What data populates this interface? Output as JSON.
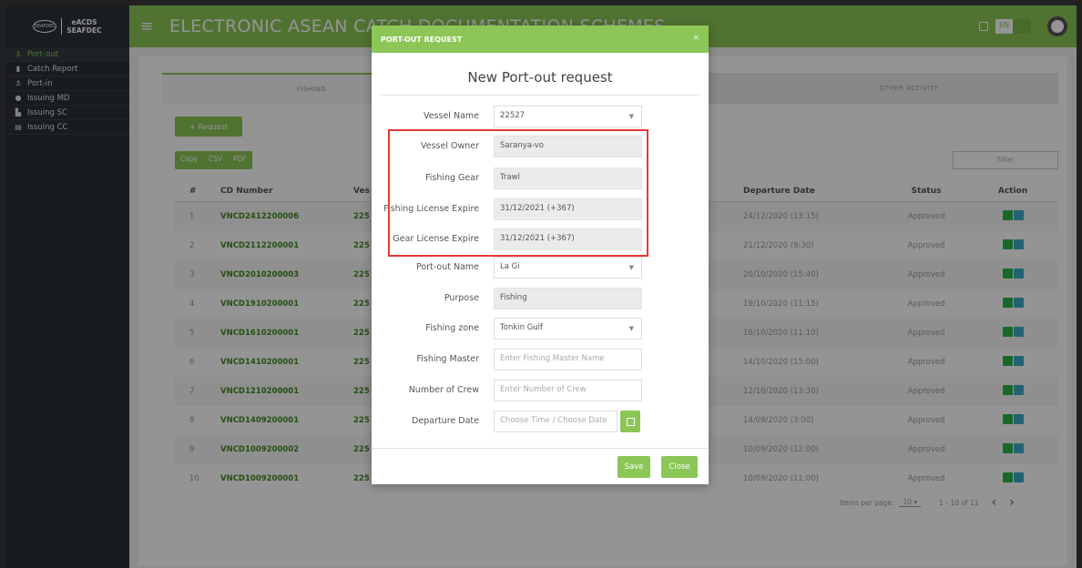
{
  "header": {
    "logo_mark": "SEAFDEC",
    "logo_line1": "eACDS",
    "logo_line2": "SEAFDEC",
    "title": "ELECTRONIC ASEAN CATCH DOCUMENTATION SCHEMES",
    "language": "EN",
    "menu_icon": "hamburger-icon"
  },
  "sidebar": {
    "items": [
      {
        "label": "Port-out",
        "icon": "ship-icon",
        "active": true
      },
      {
        "label": "Catch Report",
        "icon": "document-icon",
        "active": false
      },
      {
        "label": "Port-in",
        "icon": "anchor-icon",
        "active": false
      },
      {
        "label": "Issuing MD",
        "icon": "info-circle-icon",
        "active": false
      },
      {
        "label": "Issuing SC",
        "icon": "bar-chart-icon",
        "active": false
      },
      {
        "label": "Issuing CC",
        "icon": "card-icon",
        "active": false
      }
    ]
  },
  "main": {
    "tabs": [
      {
        "label": "FISHING"
      },
      {
        "label": "OTHER ACTIVITY"
      }
    ],
    "request_button": "+ Request",
    "export_buttons": [
      "Copy",
      "CSV",
      "PDF"
    ],
    "filter_placeholder": "Filter",
    "table": {
      "headers": {
        "num": "#",
        "cd": "CD Number",
        "vessel": "Ves",
        "departure": "Departure Date",
        "status": "Status",
        "action": "Action"
      },
      "rows": [
        {
          "num": "1",
          "cd": "VNCD2412200006",
          "vessel": "225",
          "departure": "24/12/2020 (13:15)",
          "status": "Approved"
        },
        {
          "num": "2",
          "cd": "VNCD2112200001",
          "vessel": "225",
          "departure": "21/12/2020 (9:30)",
          "status": "Approved"
        },
        {
          "num": "3",
          "cd": "VNCD2010200003",
          "vessel": "225",
          "departure": "20/10/2020 (15:40)",
          "status": "Approved"
        },
        {
          "num": "4",
          "cd": "VNCD1910200001",
          "vessel": "225",
          "departure": "19/10/2020 (11:15)",
          "status": "Approved"
        },
        {
          "num": "5",
          "cd": "VNCD1610200001",
          "vessel": "225",
          "departure": "16/10/2020 (11:10)",
          "status": "Approved"
        },
        {
          "num": "6",
          "cd": "VNCD1410200001",
          "vessel": "225",
          "departure": "14/10/2020 (15:00)",
          "status": "Approved"
        },
        {
          "num": "7",
          "cd": "VNCD1210200001",
          "vessel": "225",
          "departure": "12/10/2020 (13:30)",
          "status": "Approved"
        },
        {
          "num": "8",
          "cd": "VNCD1409200001",
          "vessel": "225",
          "departure": "14/09/2020 (3:00)",
          "status": "Approved"
        },
        {
          "num": "9",
          "cd": "VNCD1009200002",
          "vessel": "225",
          "departure": "10/09/2020 (12:00)",
          "status": "Approved"
        },
        {
          "num": "10",
          "cd": "VNCD1009200001",
          "vessel": "225",
          "departure": "10/09/2020 (11:00)",
          "status": "Approved"
        }
      ]
    },
    "pagination": {
      "items_per_page_label": "Items per page:",
      "items_per_page": "10",
      "range": "1 - 10 of 11"
    }
  },
  "modal": {
    "header": "PORT-OUT REQUEST",
    "close": "×",
    "title": "New Port-out request",
    "fields": {
      "vessel_name": {
        "label": "Vessel Name",
        "value": "22527"
      },
      "vessel_owner": {
        "label": "Vessel Owner",
        "value": "Saranya-vo"
      },
      "fishing_gear": {
        "label": "Fishing Gear",
        "value": "Trawl"
      },
      "fishing_license_expire": {
        "label": "Fishing License Expire",
        "value": "31/12/2021 (+367)"
      },
      "gear_license_expire": {
        "label": "Gear License Expire",
        "value": "31/12/2021 (+367)"
      },
      "port_out_name": {
        "label": "Port-out Name",
        "value": "La Gi"
      },
      "purpose": {
        "label": "Purpose",
        "value": "Fishing"
      },
      "fishing_zone": {
        "label": "Fishing zone",
        "value": "Tonkin Gulf"
      },
      "fishing_master": {
        "label": "Fishing Master",
        "placeholder": "Enter Fishing Master Name"
      },
      "number_of_crew": {
        "label": "Number of Crew",
        "placeholder": "Enter Number of Crew"
      },
      "departure_date": {
        "label": "Departure Date",
        "placeholder": "Choose Time   / Choose Date"
      }
    },
    "save_label": "Save",
    "close_label": "Close"
  },
  "colors": {
    "brand_green": "#8cc657",
    "sidebar_dark": "#2c3136",
    "highlight_red": "#e53935"
  }
}
